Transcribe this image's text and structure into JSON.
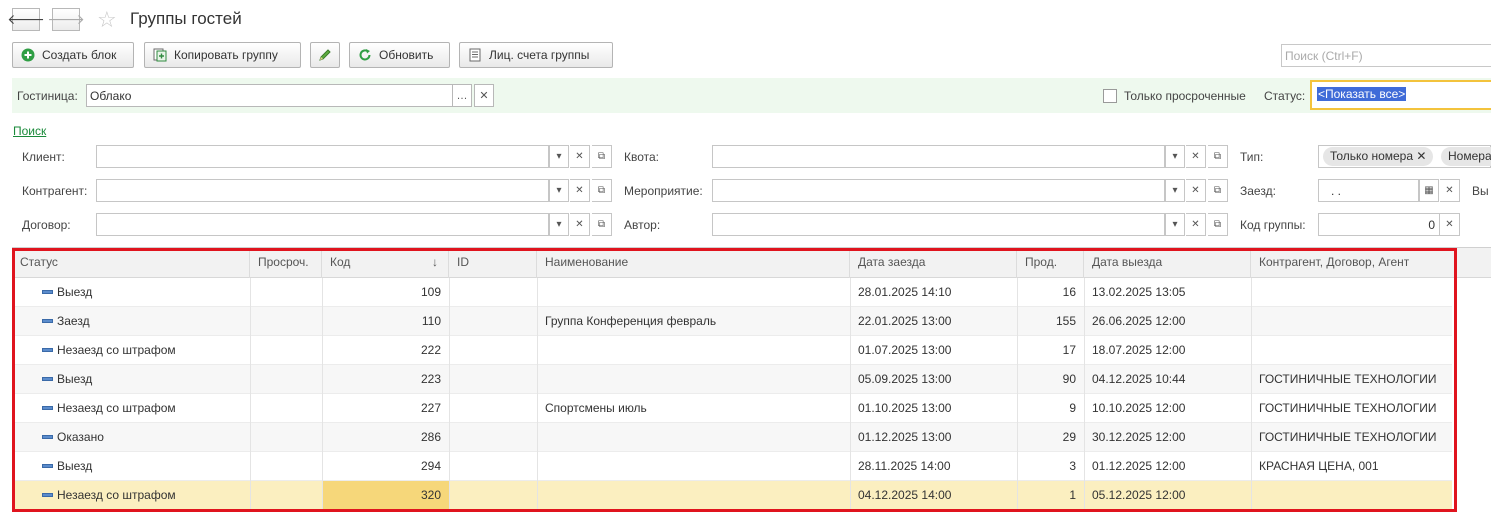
{
  "window": {
    "title": "Группы гостей"
  },
  "nav": {
    "back": "🡐",
    "forward": "🡒",
    "star": "☆"
  },
  "toolbar": {
    "create_block": "Создать блок",
    "copy_group": "Копировать группу",
    "refresh": "Обновить",
    "accounts": "Лиц. счета группы",
    "search_placeholder": "Поиск (Ctrl+F)"
  },
  "hotel_bar": {
    "hotel_label": "Гостиница:",
    "hotel_value": "Облако",
    "overdue_only_label": "Только просроченные",
    "status_label": "Статус:",
    "status_value": "<Показать все>"
  },
  "search_link": "Поиск",
  "filters": {
    "client_label": "Клиент:",
    "contractor_label": "Контрагент:",
    "contract_label": "Договор:",
    "quota_label": "Квота:",
    "event_label": "Мероприятие:",
    "author_label": "Автор:",
    "type_label": "Тип:",
    "type_tags": [
      "Только номера",
      "Номера"
    ],
    "checkin_label": "Заезд:",
    "checkin_value": ".  .",
    "checkout_label_partial": "Вы",
    "group_code_label": "Код группы:",
    "group_code_value": "0"
  },
  "table": {
    "columns": {
      "status": "Статус",
      "overdue": "Просроч.",
      "code": "Код",
      "sort_icon": "↓",
      "id": "ID",
      "name": "Наименование",
      "checkin": "Дата заезда",
      "duration": "Прод.",
      "checkout": "Дата выезда",
      "contractor": "Контрагент, Договор, Агент"
    },
    "rows": [
      {
        "status": "Выезд",
        "code": "109",
        "name": "",
        "checkin": "28.01.2025 14:10",
        "duration": "16",
        "checkout": "13.02.2025 13:05",
        "contractor": ""
      },
      {
        "status": "Заезд",
        "code": "110",
        "name": "Группа Конференция февраль",
        "checkin": "22.01.2025 13:00",
        "duration": "155",
        "checkout": "26.06.2025 12:00",
        "contractor": ""
      },
      {
        "status": "Незаезд со штрафом",
        "code": "222",
        "name": "",
        "checkin": "01.07.2025 13:00",
        "duration": "17",
        "checkout": "18.07.2025 12:00",
        "contractor": ""
      },
      {
        "status": "Выезд",
        "code": "223",
        "name": "",
        "checkin": "05.09.2025 13:00",
        "duration": "90",
        "checkout": "04.12.2025 10:44",
        "contractor": "ГОСТИНИЧНЫЕ ТЕХНОЛОГИИ"
      },
      {
        "status": "Незаезд со штрафом",
        "code": "227",
        "name": "Спортсмены июль",
        "checkin": "01.10.2025 13:00",
        "duration": "9",
        "checkout": "10.10.2025 12:00",
        "contractor": "ГОСТИНИЧНЫЕ ТЕХНОЛОГИИ"
      },
      {
        "status": "Оказано",
        "code": "286",
        "name": "",
        "checkin": "01.12.2025 13:00",
        "duration": "29",
        "checkout": "30.12.2025 12:00",
        "contractor": "ГОСТИНИЧНЫЕ ТЕХНОЛОГИИ"
      },
      {
        "status": "Выезд",
        "code": "294",
        "name": "",
        "checkin": "28.11.2025 14:00",
        "duration": "3",
        "checkout": "01.12.2025 12:00",
        "contractor": "КРАСНАЯ ЦЕНА, 001"
      },
      {
        "status": "Незаезд со штрафом",
        "code": "320",
        "name": "",
        "checkin": "04.12.2025 14:00",
        "duration": "1",
        "checkout": "05.12.2025 12:00",
        "contractor": ""
      }
    ]
  },
  "colors": {
    "accent_green": "#1a8a3a",
    "highlight_red": "#e0141e",
    "selected_row": "#fbefc0"
  }
}
